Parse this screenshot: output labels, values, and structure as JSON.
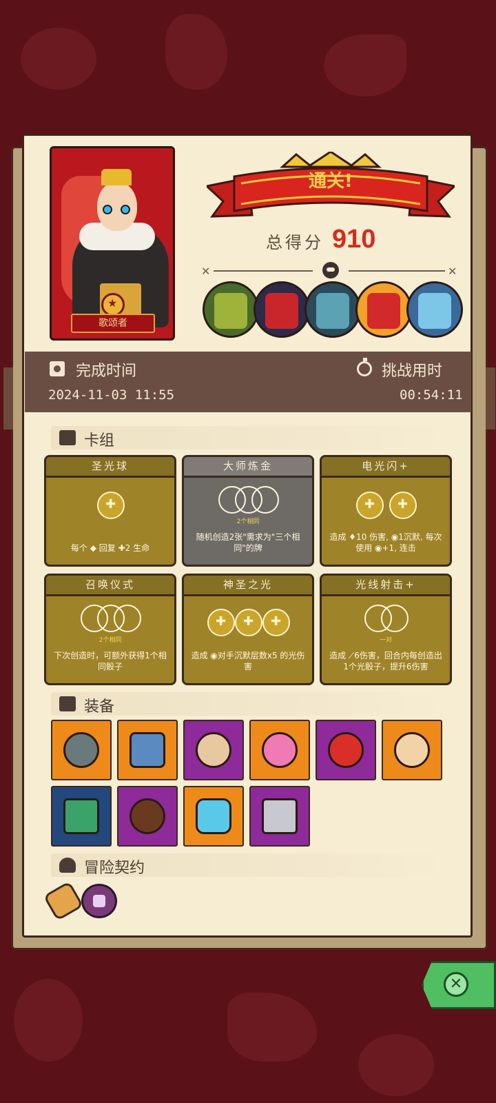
{
  "hero": {
    "name": "歌颂者"
  },
  "result": {
    "banner": "通关!",
    "score_label": "总得分",
    "score_value": "910"
  },
  "bosses": [
    {
      "icon": "knight-boss-icon",
      "color": "#9fb23a"
    },
    {
      "icon": "cage-boss-icon",
      "color": "#c9262c"
    },
    {
      "icon": "fish-boss-icon",
      "color": "#5aa2b4"
    },
    {
      "icon": "clown-boss-icon",
      "color": "#d22a2a"
    },
    {
      "icon": "frost-boss-icon",
      "color": "#7cc6e8"
    }
  ],
  "time_bar": {
    "complete_label": "完成时间",
    "complete_value": "2024-11-03 11:55",
    "challenge_label": "挑战用时",
    "challenge_value": "00:54:11"
  },
  "deck": {
    "heading": "卡组",
    "cards": [
      {
        "title": "圣光球",
        "sub": "",
        "desc": "每个 ◆ 回复 ✚2 生命"
      },
      {
        "title": "大师炼金",
        "sub": "2个相同",
        "desc": "随机创造2张\"需求为\"三个相同\"的牌"
      },
      {
        "title": "电光闪+",
        "sub": "",
        "desc": "造成 ♦10 伤害, ◉1沉默, 每次使用 ◉+1, 连击"
      },
      {
        "title": "召唤仪式",
        "sub": "2个相同",
        "desc": "下次创造时，可额外获得1个相同骰子"
      },
      {
        "title": "神圣之光",
        "sub": "",
        "desc": "造成 ◉对手沉默层数x5 的光伤害"
      },
      {
        "title": "光线射击+",
        "sub": "一对",
        "desc": "造成 ⟋6伤害，回合内每创造出1个光骰子，提升6伤害"
      }
    ]
  },
  "equipment": {
    "heading": "装备",
    "items": [
      {
        "icon": "stone-charm-icon",
        "bg": "#ee8a1a"
      },
      {
        "icon": "bottle-fish-icon",
        "bg": "#ee8a1a"
      },
      {
        "icon": "sun-mask-icon",
        "bg": "#8e2a9a"
      },
      {
        "icon": "lotus-icon",
        "bg": "#ee8a1a"
      },
      {
        "icon": "ring-icon",
        "bg": "#8e2a9a"
      },
      {
        "icon": "shield-orb-icon",
        "bg": "#ee8a1a"
      },
      {
        "icon": "totem-icon",
        "bg": "#23487e"
      },
      {
        "icon": "button-icon",
        "bg": "#8e2a9a"
      },
      {
        "icon": "crystal-icon",
        "bg": "#ee8a1a"
      },
      {
        "icon": "cube-icon",
        "bg": "#8e2a9a"
      }
    ]
  },
  "contract": {
    "heading": "冒险契约"
  }
}
